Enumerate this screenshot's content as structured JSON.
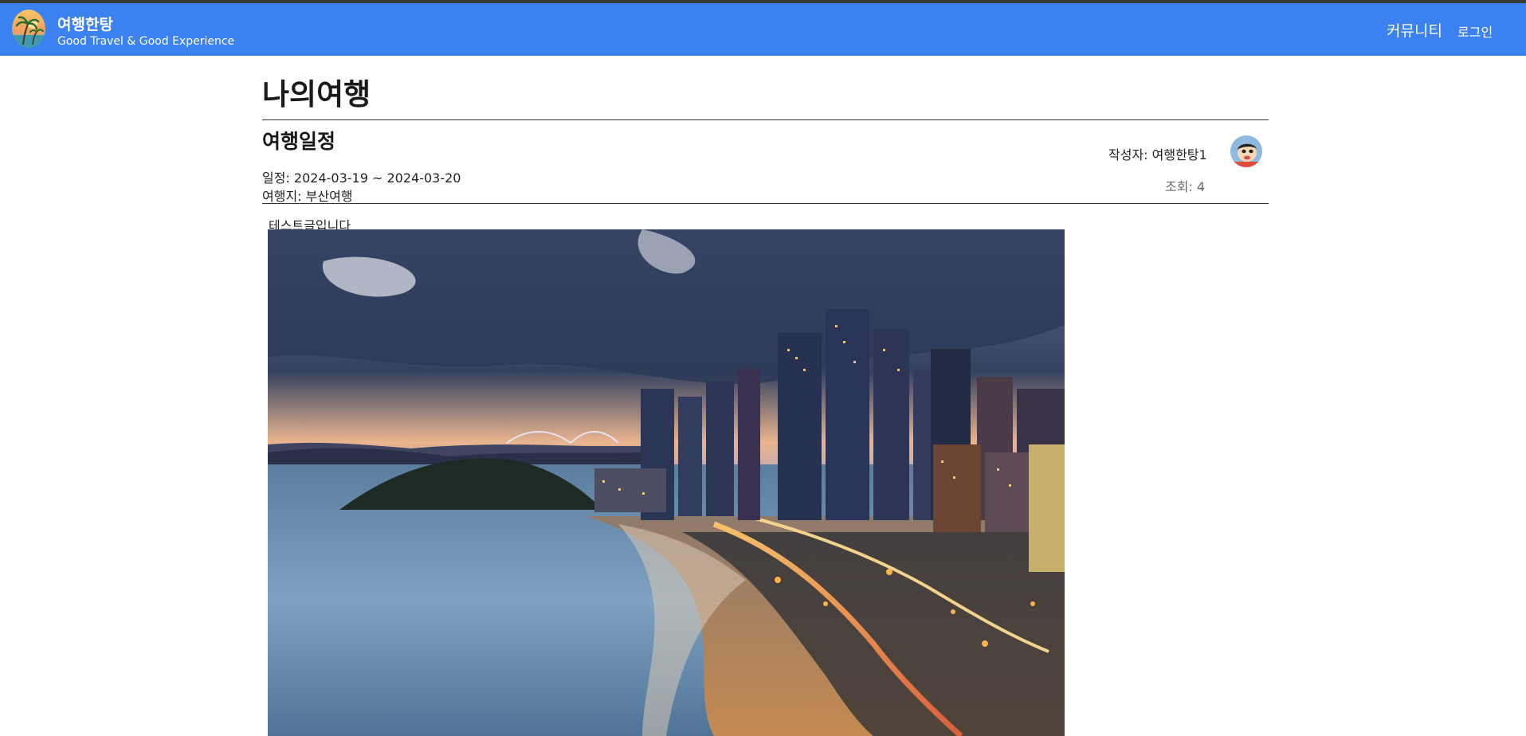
{
  "header": {
    "brand_title": "여행한탕",
    "brand_subtitle": "Good Travel & Good Experience",
    "nav": {
      "community": "커뮤니티",
      "login": "로그인"
    }
  },
  "page": {
    "title": "나의여행"
  },
  "post": {
    "section_title": "여행일정",
    "schedule": "일정: 2024-03-19 ~ 2024-03-20",
    "destination": "여행지: 부산여행",
    "author": "작성자: 여행한탕1",
    "views": "조회: 4",
    "body": "테스트글입니다"
  },
  "icons": {
    "logo": "palm-tree-logo-icon",
    "avatar": "user-avatar-icon"
  },
  "colors": {
    "navbar": "#3b82f0",
    "text": "#222222"
  }
}
